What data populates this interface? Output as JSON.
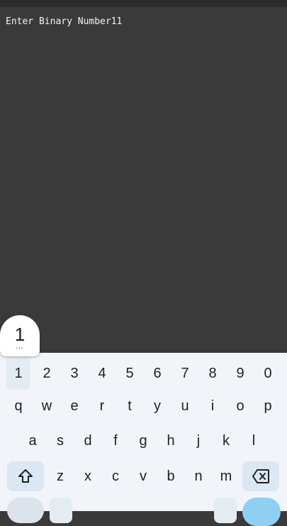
{
  "terminal": {
    "prompt_text": "Enter Binary Number11"
  },
  "key_popup": {
    "char": "1",
    "more": "…"
  },
  "keyboard": {
    "row_numbers": [
      "1",
      "2",
      "3",
      "4",
      "5",
      "6",
      "7",
      "8",
      "9",
      "0"
    ],
    "row_1": [
      "q",
      "w",
      "e",
      "r",
      "t",
      "y",
      "u",
      "i",
      "o",
      "p"
    ],
    "row_2": [
      "a",
      "s",
      "d",
      "f",
      "g",
      "h",
      "j",
      "k",
      "l"
    ],
    "row_3": [
      "z",
      "x",
      "c",
      "v",
      "b",
      "n",
      "m"
    ],
    "shift_icon": "shift-icon",
    "backspace_icon": "backspace-icon",
    "colors": {
      "keyboard_bg": "#f1f5f9",
      "func_key_bg": "#dbe7f3",
      "enter_key_bg": "#8fd0f2"
    }
  }
}
